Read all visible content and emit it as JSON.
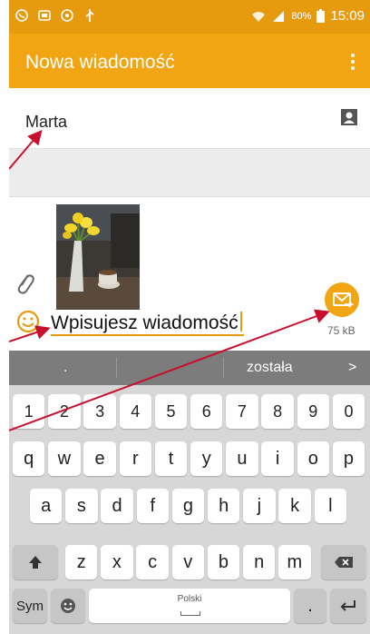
{
  "status": {
    "battery": "80%",
    "time": "15:09"
  },
  "appbar": {
    "title": "Nowa wiadomość"
  },
  "recipient": {
    "name": "Marta"
  },
  "compose": {
    "message": "Wpisujesz wiadomość",
    "attachment_size": "75 kB"
  },
  "keyboard": {
    "suggestions": [
      ".",
      ".",
      "została",
      ">"
    ],
    "row_numbers": [
      "1",
      "2",
      "3",
      "4",
      "5",
      "6",
      "7",
      "8",
      "9",
      "0"
    ],
    "row_1": [
      "q",
      "w",
      "e",
      "r",
      "t",
      "y",
      "u",
      "i",
      "o",
      "p"
    ],
    "row_2": [
      "a",
      "s",
      "d",
      "f",
      "g",
      "h",
      "j",
      "k",
      "l"
    ],
    "row_3": [
      "z",
      "x",
      "c",
      "v",
      "b",
      "n",
      "m"
    ],
    "sym_label": "Sym",
    "space_label": "Polski",
    "period": "."
  },
  "colors": {
    "accent": "#f1a512",
    "status_bar": "#e59b0d",
    "arrow": "#c8102e"
  }
}
